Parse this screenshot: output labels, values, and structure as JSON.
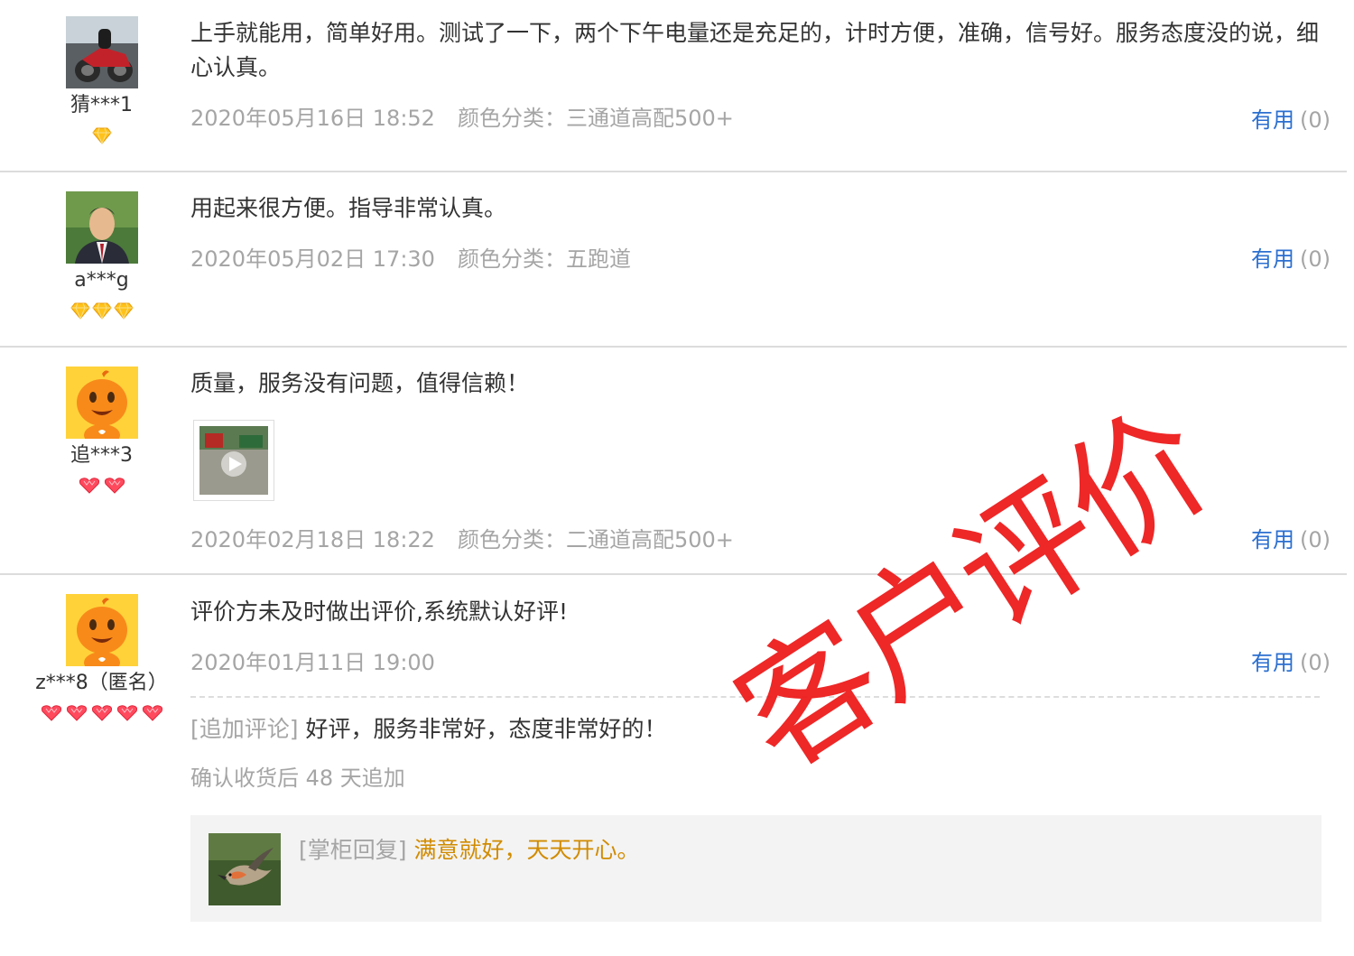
{
  "reviews": [
    {
      "user": "猜***1",
      "text": "上手就能用，简单好用。测试了一下，两个下午电量还是充足的，计时方便，准确，信号好。服务态度没的说，细心认真。",
      "date": "2020年05月16日 18:52",
      "sku": "颜色分类：三通道高配500+",
      "useful_label": "有用",
      "useful_count": "(0)",
      "rank_icon": "diamond-icon",
      "rank_count": 1
    },
    {
      "user": "a***g",
      "text": "用起来很方便。指导非常认真。",
      "date": "2020年05月02日 17:30",
      "sku": "颜色分类：五跑道",
      "useful_label": "有用",
      "useful_count": "(0)",
      "rank_icon": "diamond-icon",
      "rank_count": 3
    },
    {
      "user": "追***3",
      "text": "质量，服务没有问题，值得信赖！",
      "date": "2020年02月18日 18:22",
      "sku": "颜色分类：二通道高配500+",
      "useful_label": "有用",
      "useful_count": "(0)",
      "rank_icon": "heart-icon",
      "rank_count": 2,
      "has_video": true
    },
    {
      "user": "z***8（匿名）",
      "text": "评价方未及时做出评价,系统默认好评!",
      "date": "2020年01月11日 19:00",
      "useful_label": "有用",
      "useful_count": "(0)",
      "rank_icon": "heart-icon",
      "rank_count": 5,
      "append_tag": "[追加评论]",
      "append_text": "好评，服务非常好，态度非常好的！",
      "append_after": "确认收货后 48 天追加",
      "reply_tag": "[掌柜回复]",
      "reply_text": "满意就好，天天开心。"
    }
  ],
  "stamp": "客户评价",
  "colors": {
    "link": "#2b6fd0",
    "meta": "#a5a5a5",
    "reply_text": "#d18b00",
    "stamp": "#ee1c1c",
    "divider": "#dcdcdc",
    "reply_bg": "#f3f3f3"
  }
}
